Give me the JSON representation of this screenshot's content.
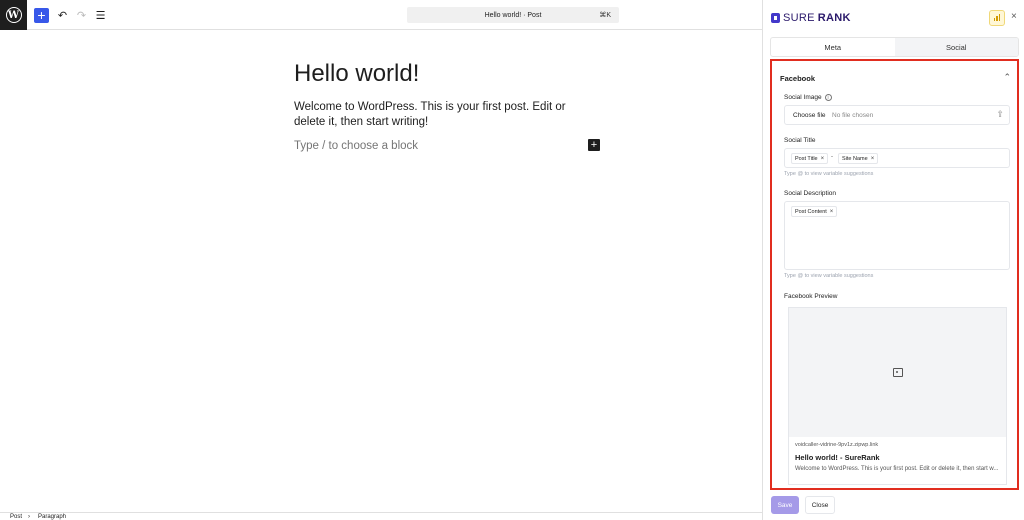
{
  "toolbar": {
    "add_icon": "+",
    "undo_icon": "↶",
    "redo_icon": "↷",
    "list_icon": "☰",
    "document_title": "Hello world! · Post",
    "shortcut": "⌘K"
  },
  "editor": {
    "title": "Hello world!",
    "paragraph": "Welcome to WordPress. This is your first post. Edit or delete it, then start writing!",
    "placeholder": "Type / to choose a block",
    "block_add_icon": "+"
  },
  "statusbar": {
    "breadcrumb_1": "Post",
    "separator": "›",
    "breadcrumb_2": "Paragraph"
  },
  "sidebar": {
    "brand_sure": "SURE",
    "brand_rank": "RANK",
    "close_icon": "×",
    "tabs": [
      {
        "label": "Meta"
      },
      {
        "label": "Social"
      }
    ],
    "facebook": {
      "heading": "Facebook",
      "chevron": "⌃",
      "social_image_label": "Social Image",
      "info_icon": "i",
      "choose_file": "Choose file",
      "no_file": "No file chosen",
      "upload_icon": "⇪",
      "social_title_label": "Social Title",
      "title_chips": [
        "Post Title",
        "Site Name"
      ],
      "chip_separator": "-",
      "chip_remove": "×",
      "hint": "Type @ to view variable suggestions",
      "social_description_label": "Social Description",
      "description_chips": [
        "Post Content"
      ],
      "preview_label": "Facebook Preview",
      "preview": {
        "url": "voidcaller-vidrine-9pv1z.zipwp.link",
        "title": "Hello world! - SureRank",
        "description": "Welcome to WordPress. This is your first post. Edit or delete it, then start w..."
      }
    },
    "save_label": "Save",
    "close_label": "Close"
  },
  "colors": {
    "accent": "#3858e9",
    "highlight_border": "#e12d1f",
    "save_button": "#a59ae8"
  }
}
